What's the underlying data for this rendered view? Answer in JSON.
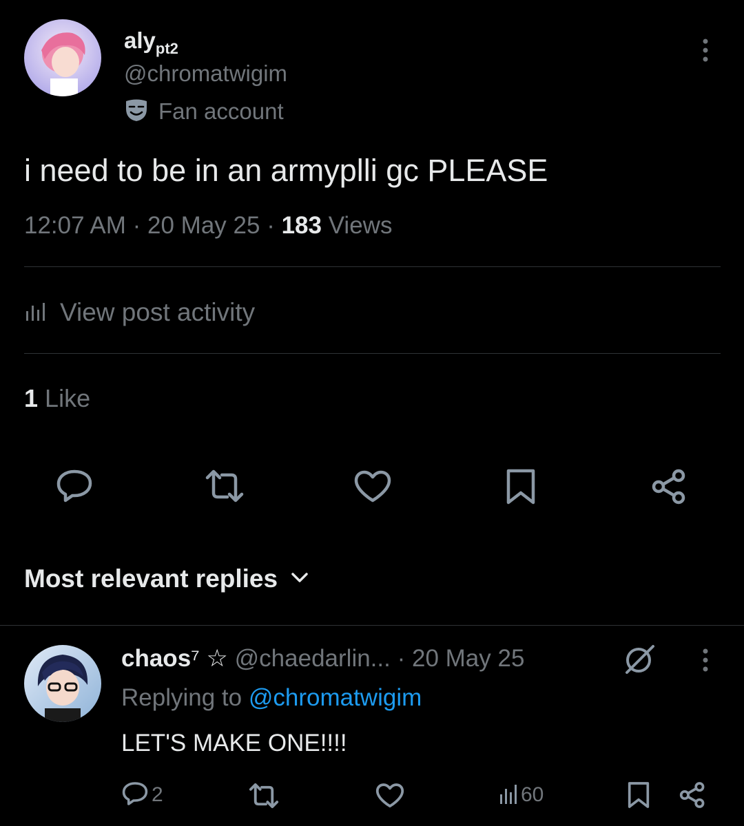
{
  "post": {
    "display_name": "aly",
    "display_name_sub": "pt2",
    "handle": "@chromatwigim",
    "label_text": "Fan account",
    "body": "i need to be in an armyplli gc PLEASE",
    "time": "12:07 AM",
    "date": "20 May 25",
    "views_count": "183",
    "views_label": "Views",
    "activity_label": "View post activity",
    "likes_count": "1",
    "likes_label": "Like",
    "menu_icon": "more-vertical-icon"
  },
  "actions": [
    "reply-icon",
    "repost-icon",
    "like-icon",
    "bookmark-icon",
    "share-icon"
  ],
  "replies_sort": {
    "label": "Most relevant replies"
  },
  "reply": {
    "display_name": "chaos",
    "name_suffix": "⁷ ☆",
    "handle": "@chaedarlin...",
    "date": "· 20 May 25",
    "replying_prefix": "Replying to",
    "replying_handle": "@chromatwigim",
    "body": "LET'S MAKE ONE!!!!",
    "reply_count": "2",
    "views_count": "60"
  },
  "colors": {
    "background": "#000000",
    "text": "#e7e9ea",
    "muted": "#71767b",
    "link": "#1d9bf0",
    "divider": "#2f3336"
  }
}
